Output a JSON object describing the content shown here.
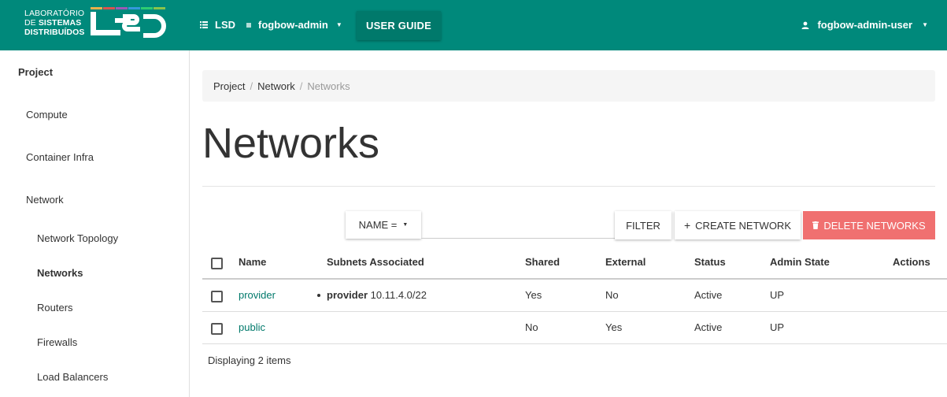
{
  "header": {
    "logo_lines": [
      "LABORATÓRIO",
      "DE",
      "SISTEMAS",
      "DISTRIBUÍDOS"
    ],
    "domain": "LSD",
    "project": "fogbow-admin",
    "user_guide_label": "USER GUIDE",
    "user": "fogbow-admin-user"
  },
  "sidebar": {
    "section": "Project",
    "items": [
      "Compute",
      "Container Infra",
      "Network"
    ],
    "sub_items": [
      "Network Topology",
      "Networks",
      "Routers",
      "Firewalls",
      "Load Balancers"
    ],
    "active_sub_item": "Networks"
  },
  "breadcrumb": [
    "Project",
    "Network",
    "Networks"
  ],
  "page_title": "Networks",
  "toolbar": {
    "name_dropdown": "NAME =",
    "filter_placeholder": "",
    "filter_label": "FILTER",
    "create_label": "CREATE NETWORK",
    "delete_label": "DELETE NETWORKS"
  },
  "table": {
    "columns": [
      "Name",
      "Subnets Associated",
      "Shared",
      "External",
      "Status",
      "Admin State",
      "Actions"
    ],
    "rows": [
      {
        "name": "provider",
        "subnet_name": "provider",
        "subnet_cidr": "10.11.4.0/22",
        "shared": "Yes",
        "external": "No",
        "status": "Active",
        "admin_state": "UP"
      },
      {
        "name": "public",
        "subnet_name": "",
        "subnet_cidr": "",
        "shared": "No",
        "external": "Yes",
        "status": "Active",
        "admin_state": "UP"
      }
    ],
    "footer": "Displaying 2 items"
  },
  "colors": {
    "header_bg": "#00897b",
    "user_guide_bg": "#00796b",
    "delete_bg": "#f07070",
    "link": "#00796b"
  },
  "logo_stripe_colors": [
    "#e8b04a",
    "#d9534f",
    "#9b59b6",
    "#3498db",
    "#2ecc71",
    "#8bc34a"
  ]
}
